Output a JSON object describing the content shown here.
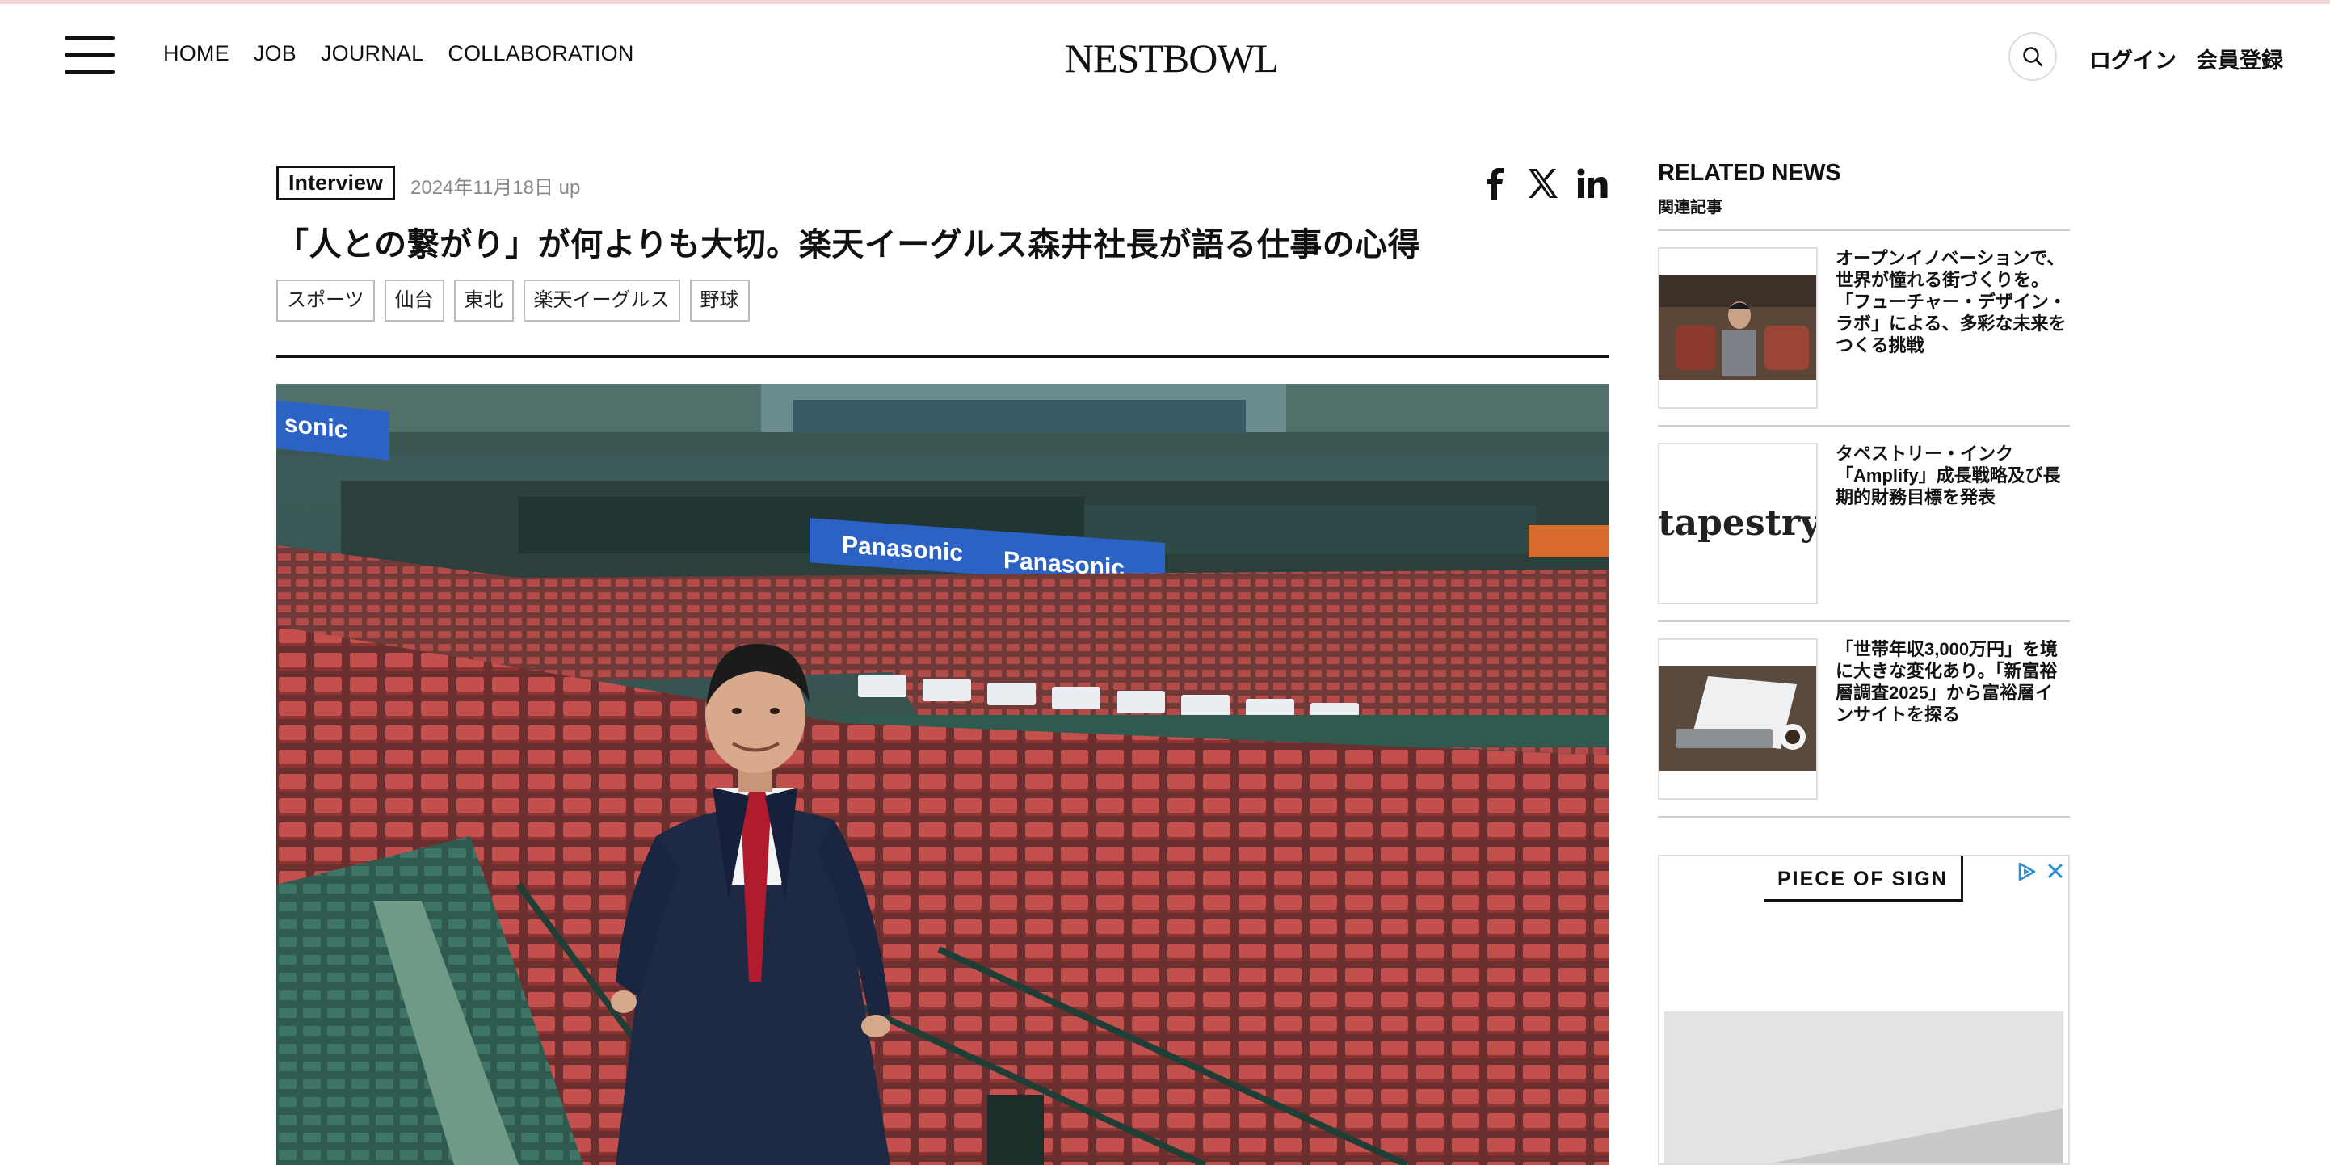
{
  "header": {
    "nav": [
      "HOME",
      "JOB",
      "JOURNAL",
      "COLLABORATION"
    ],
    "logo": "NESTBOWL",
    "login": "ログイン",
    "register": "会員登録"
  },
  "article": {
    "category": "Interview",
    "date": "2024年11月18日 up",
    "title": "「人との繋がり」が何よりも大切。楽天イーグルス森井社長が語る仕事の心得",
    "tags": [
      "スポーツ",
      "仙台",
      "東北",
      "楽天イーグルス",
      "野球"
    ],
    "hero_signs": {
      "sign1": "Panasonic",
      "sign2": "Panasonic",
      "sign3": "sonic"
    }
  },
  "sidebar": {
    "title": "RELATED NEWS",
    "subtitle": "関連記事",
    "items": [
      {
        "text": "オープンイノベーションで、世界が憧れる街づくりを。「フューチャー・デザイン・ラボ」による、多彩な未来をつくる挑戦"
      },
      {
        "text": "タペストリー・インク「Amplify」成長戦略及び長期的財務目標を発表",
        "thumb_logo": "tapestry"
      },
      {
        "text": "「世帯年収3,000万円」を境に大きな変化あり。「新富裕層調査2025」から富裕層インサイトを探る"
      }
    ],
    "ad_label": "PIECE OF SIGN"
  },
  "icons": [
    "hamburger-icon",
    "search-icon",
    "facebook-icon",
    "x-icon",
    "linkedin-icon",
    "adchoices-icon",
    "close-icon"
  ]
}
